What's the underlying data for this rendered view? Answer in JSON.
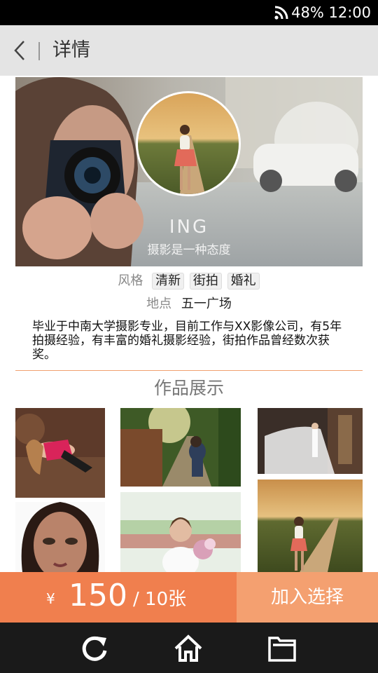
{
  "status_bar": {
    "battery": "48%",
    "time": "12:00",
    "icons": [
      "wifi-icon"
    ]
  },
  "header": {
    "title": "详情",
    "back_icon": "back-arrow-icon"
  },
  "profile": {
    "name": "ING",
    "motto": "摄影是一种态度",
    "style_label": "风格",
    "styles": [
      "清新",
      "街拍",
      "婚礼"
    ],
    "location_label": "地点",
    "location": "五一广场",
    "bio": "毕业于中南大学摄影专业，目前工作与XX影像公司，有5年拍摄经验，有丰富的婚礼摄影经验，街拍作品曾经数次获奖。"
  },
  "gallery": {
    "title": "作品展示",
    "photos": [
      "portrait-lying-on-ground",
      "woman-in-garden-path",
      "bride-long-veil",
      "woman-face-closeup",
      "woman-with-flowers",
      "girl-on-country-road"
    ]
  },
  "footer": {
    "currency": "¥",
    "price": "150",
    "unit": "/ 10张",
    "add_button": "加入选择"
  },
  "bottom_nav": {
    "items": [
      "refresh-icon",
      "home-icon",
      "folder-icon"
    ]
  },
  "colors": {
    "accent": "#f07f4e",
    "accent_light": "#f4a070",
    "nav_bg": "#e4e4e4",
    "bottom_bg": "#1a1a1a"
  }
}
